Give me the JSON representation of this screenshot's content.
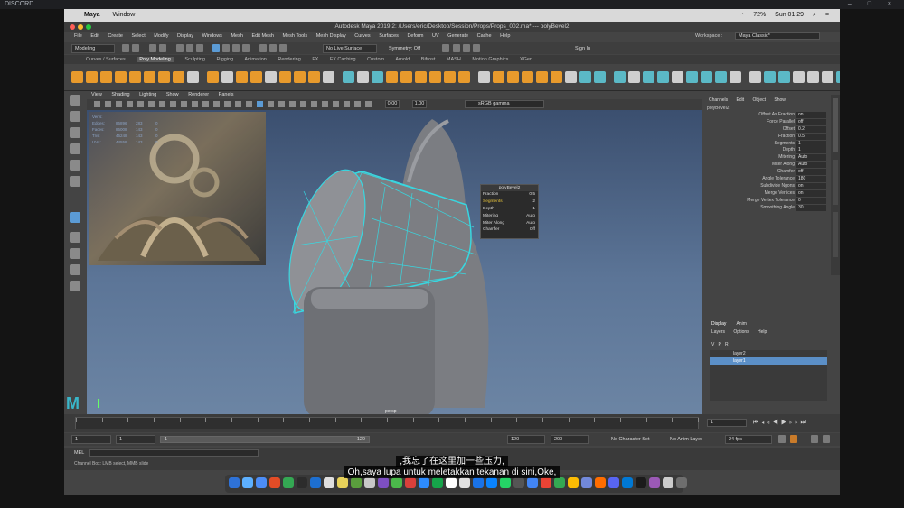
{
  "discord": {
    "app_name": "DISCORD",
    "window_controls": "–  □  ×"
  },
  "macbar": {
    "apple": "",
    "app": "Maya",
    "menus": [
      "Window"
    ],
    "battery": "72%",
    "time": "Sun 01.29"
  },
  "titlebar": {
    "title": "Autodesk Maya 2019.2: /Users/eric/Desktop/Session/Props/Props_002.ma*   ---   polyBevel2"
  },
  "menubar": {
    "items": [
      "File",
      "Edit",
      "Create",
      "Select",
      "Modify",
      "Display",
      "Windows",
      "Mesh",
      "Edit Mesh",
      "Mesh Tools",
      "Mesh Display",
      "Curves",
      "Surfaces",
      "Deform",
      "UV",
      "Generate",
      "Cache",
      "Help"
    ],
    "workspace_label": "Workspace :",
    "workspace_value": "Maya Classic*"
  },
  "statusline": {
    "mode": "Modeling",
    "live_surface": "No Live Surface",
    "symmetry": "Symmetry: Off",
    "sign_in": "Sign In"
  },
  "shelf": {
    "tabs": [
      "Curves / Surfaces",
      "Poly Modeling",
      "Sculpting",
      "Rigging",
      "Animation",
      "Rendering",
      "FX",
      "FX Caching",
      "Custom",
      "Arnold",
      "Bifrost",
      "MASH",
      "Motion Graphics",
      "XGen"
    ],
    "active_tab": "Poly Modeling",
    "accent_color": "#e89a2c"
  },
  "panel": {
    "menus": [
      "View",
      "Shading",
      "Lighting",
      "Show",
      "Renderer",
      "Panels"
    ],
    "exposure": "0.00",
    "gamma": "1.00",
    "color_space": "sRGB gamma"
  },
  "viewport": {
    "camera": "persp",
    "hud_rows": [
      {
        "label": "Verts:",
        "a": "",
        "b": "",
        "c": ""
      },
      {
        "label": "Edges:",
        "a": "86896",
        "b": "283",
        "c": "0"
      },
      {
        "label": "Faces:",
        "a": "86008",
        "b": "143",
        "c": "0"
      },
      {
        "label": "Tris:",
        "a": "46248",
        "b": "143",
        "c": "0"
      },
      {
        "label": "UVs:",
        "a": "44558",
        "b": "143",
        "c": "0"
      }
    ]
  },
  "bevel_popup": {
    "title": "polyBevel2",
    "rows": [
      {
        "label": "Fraction",
        "value": "0.5"
      },
      {
        "label": "Segments",
        "value": "2"
      },
      {
        "label": "Depth",
        "value": "1"
      },
      {
        "label": "Mitering",
        "value": "Auto"
      },
      {
        "label": "Miter Along",
        "value": "Auto"
      },
      {
        "label": "Chamfer",
        "value": "Off"
      }
    ]
  },
  "channel_box": {
    "tabs": [
      "Channels",
      "Edit",
      "Object",
      "Show"
    ],
    "node": "polyBevel2",
    "attrs": [
      {
        "label": "Offset As Fraction",
        "value": "on"
      },
      {
        "label": "Force Parallel",
        "value": "off"
      },
      {
        "label": "Offset",
        "value": "0.2"
      },
      {
        "label": "Fraction",
        "value": "0.5"
      },
      {
        "label": "Segments",
        "value": "1"
      },
      {
        "label": "Depth",
        "value": "1"
      },
      {
        "label": "Mitering",
        "value": "Auto"
      },
      {
        "label": "Miter Along",
        "value": "Auto"
      },
      {
        "label": "Chamfer",
        "value": "off"
      },
      {
        "label": "Angle Tolerance",
        "value": "180"
      },
      {
        "label": "Subdivide Ngons",
        "value": "on"
      },
      {
        "label": "Merge Vertices",
        "value": "on"
      },
      {
        "label": "Merge Vertex Tolerance",
        "value": "0"
      },
      {
        "label": "Smoothing Angle",
        "value": "30"
      }
    ]
  },
  "layer_editor": {
    "tabs": [
      "Display",
      "Anim"
    ],
    "menus": [
      "Layers",
      "Options",
      "Help"
    ],
    "columns": [
      "V",
      "P",
      "R"
    ],
    "layers": [
      {
        "name": "layer2",
        "selected": false
      },
      {
        "name": "layer1",
        "selected": true
      }
    ]
  },
  "timeline": {
    "current_frame": "1"
  },
  "range": {
    "start": "1",
    "anim_start": "1",
    "range_start_label": "1",
    "range_end_label": "120",
    "range_end": "120",
    "anim_end": "200",
    "character_set": "No Character Set",
    "anim_layer": "No Anim Layer",
    "fps": "24 fps"
  },
  "mel": {
    "label": "MEL"
  },
  "helpline": {
    "text": "Channel Box: LMB select, MMB slide"
  },
  "subtitles": {
    "line1": ",我忘了在这里加一些压力,",
    "line2": "Oh,saya lupa untuk meletakkan tekanan di sini,Oke,"
  }
}
